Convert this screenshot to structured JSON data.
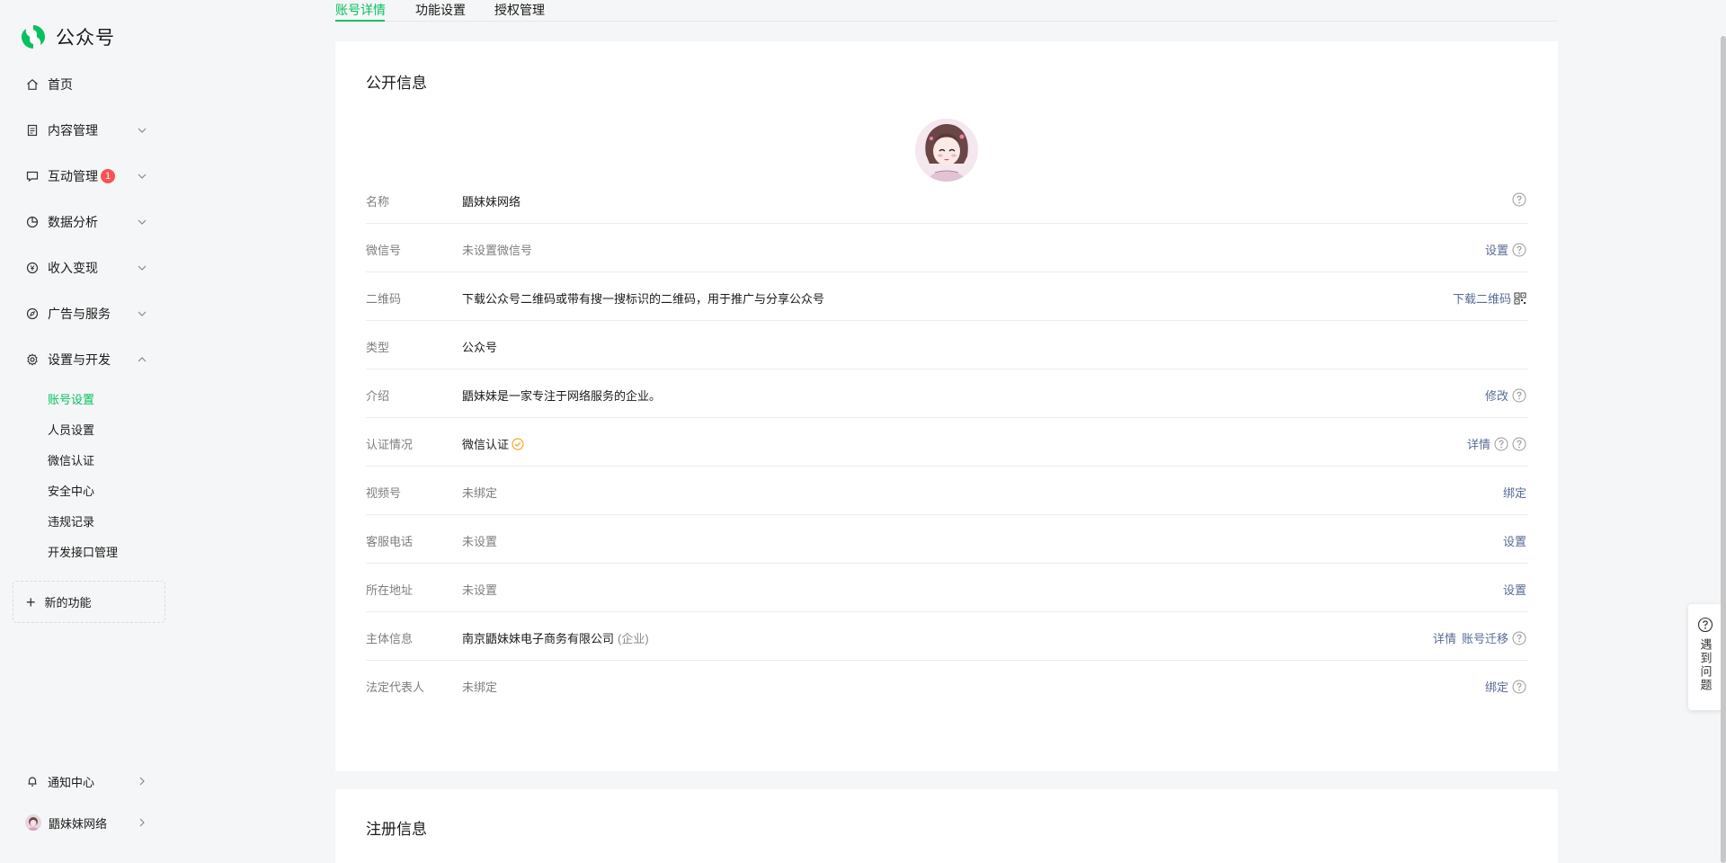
{
  "sidebar": {
    "brand": "公众号",
    "nav": [
      {
        "label": "首页",
        "icon": "home-icon"
      },
      {
        "label": "内容管理",
        "icon": "document-icon"
      },
      {
        "label": "互动管理",
        "icon": "chat-icon",
        "badge": "1"
      },
      {
        "label": "数据分析",
        "icon": "pie-chart-icon"
      },
      {
        "label": "收入变现",
        "icon": "yen-icon"
      },
      {
        "label": "广告与服务",
        "icon": "compass-icon"
      },
      {
        "label": "设置与开发",
        "icon": "gear-icon"
      }
    ],
    "sub": [
      {
        "label": "账号设置",
        "active": true
      },
      {
        "label": "人员设置"
      },
      {
        "label": "微信认证"
      },
      {
        "label": "安全中心"
      },
      {
        "label": "违规记录"
      },
      {
        "label": "开发接口管理"
      }
    ],
    "new_function": "新的功能",
    "notification": "通知中心",
    "account_name": "鼯妹妹网络"
  },
  "tabs": [
    "账号详情",
    "功能设置",
    "授权管理"
  ],
  "public_info": {
    "title": "公开信息",
    "rows": [
      {
        "label": "名称",
        "value": "鼯妹妹网络",
        "actions": []
      },
      {
        "label": "微信号",
        "value": "未设置微信号",
        "actions": [
          "设置"
        ]
      },
      {
        "label": "二维码",
        "value": "下载公众号二维码或带有搜一搜标识的二维码，用于推广与分享公众号",
        "actions": [
          "下载二维码"
        ]
      },
      {
        "label": "类型",
        "value": "公众号",
        "actions": []
      },
      {
        "label": "介绍",
        "value": "鼯妹妹是一家专注于网络服务的企业。",
        "actions": [
          "修改"
        ]
      },
      {
        "label": "认证情况",
        "value": "微信认证",
        "actions": [
          "详情"
        ]
      },
      {
        "label": "视频号",
        "value": "未绑定",
        "actions": [
          "绑定"
        ]
      },
      {
        "label": "客服电话",
        "value": "未设置",
        "actions": [
          "设置"
        ]
      },
      {
        "label": "所在地址",
        "value": "未设置",
        "actions": [
          "设置"
        ]
      },
      {
        "label": "主体信息",
        "value": "南京鼯妹妹电子商务有限公司",
        "value_sub": "(企业)",
        "actions": [
          "详情",
          "账号迁移"
        ]
      },
      {
        "label": "法定代表人",
        "value": "未绑定",
        "actions": [
          "绑定"
        ]
      }
    ]
  },
  "registration_info": {
    "title": "注册信息"
  },
  "help_float": "遇到问题",
  "colors": {
    "accent": "#07c160",
    "link": "#576b95",
    "badge": "#fa5151",
    "verified": "#f5a623"
  }
}
